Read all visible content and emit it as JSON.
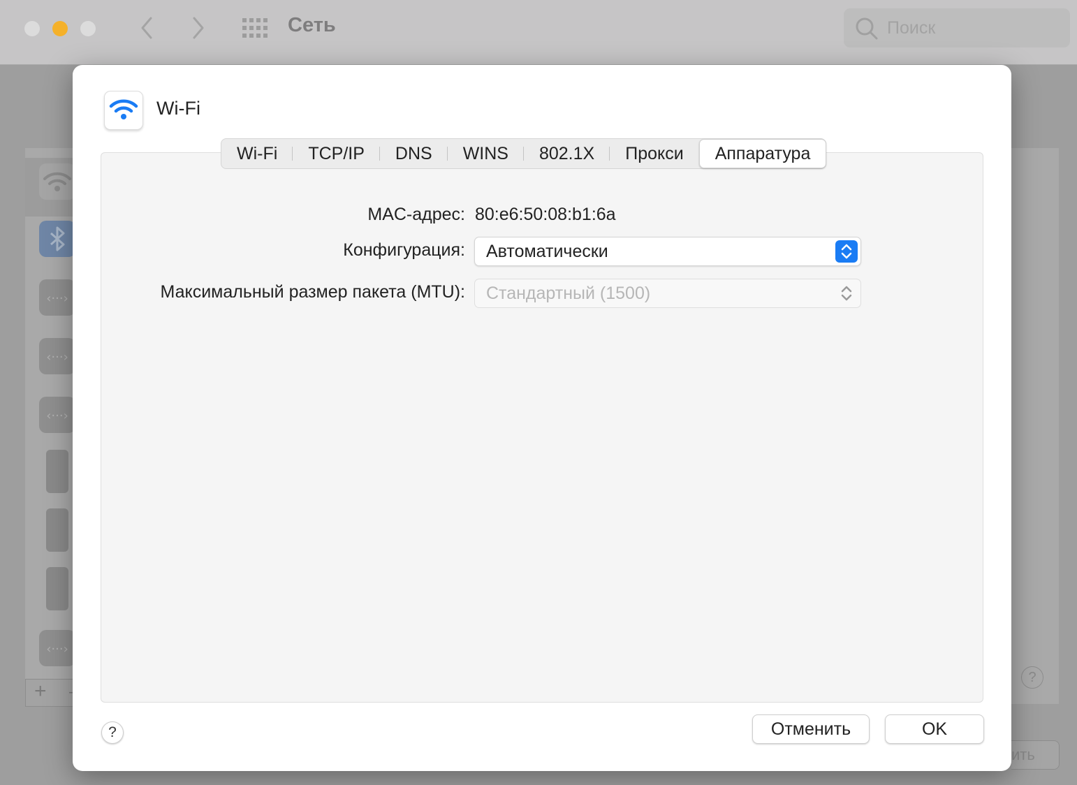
{
  "window": {
    "title": "Сеть",
    "search_placeholder": "Поиск",
    "bg_button_partial": "ить"
  },
  "sheet": {
    "service_name": "Wi-Fi",
    "tabs": [
      {
        "label": "Wi-Fi",
        "active": false
      },
      {
        "label": "TCP/IP",
        "active": false
      },
      {
        "label": "DNS",
        "active": false
      },
      {
        "label": "WINS",
        "active": false
      },
      {
        "label": "802.1X",
        "active": false
      },
      {
        "label": "Прокси",
        "active": false
      },
      {
        "label": "Аппаратура",
        "active": true
      }
    ],
    "mac_label": "MAC-адрес:",
    "mac_value": "80:e6:50:08:b1:6a",
    "config_label": "Конфигурация:",
    "config_value": "Автоматически",
    "mtu_label": "Максимальный размер пакета (MTU):",
    "mtu_value": "Стандартный (1500)",
    "help_label": "?",
    "cancel_label": "Отменить",
    "ok_label": "OK"
  },
  "colors": {
    "accent": "#1a7cf4",
    "traffic_light_minimize": "#f5b12a"
  }
}
